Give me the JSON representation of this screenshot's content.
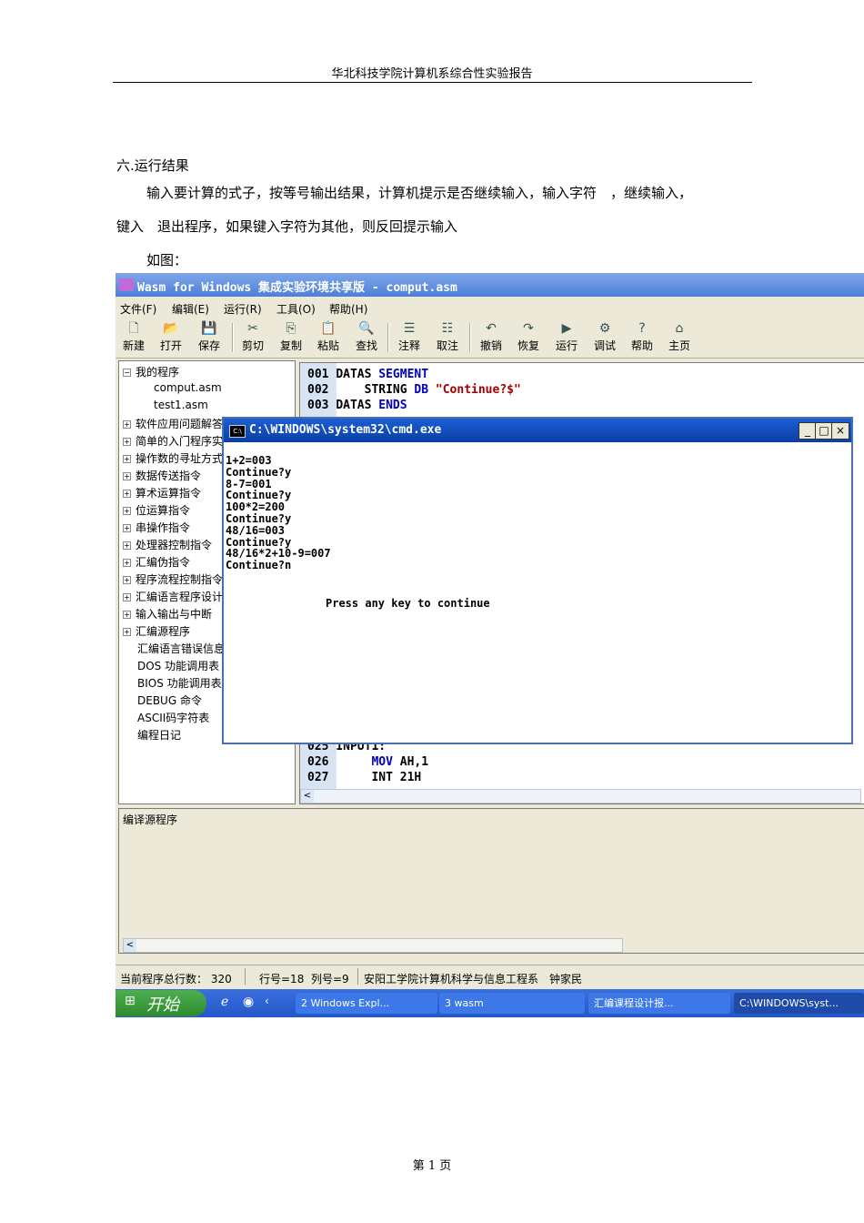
{
  "header": "华北科技学院计算机系综合性实验报告",
  "section_title": "六.运行结果",
  "para1": "输入要计算的式子，按等号输出结果，计算机提示是否继续输入，输入字符　，继续输入，",
  "para2": "键入　退出程序，如果键入字符为其他，则反回提示输入",
  "para3": "如图：",
  "footer": "第 1 页",
  "app": {
    "title": "Wasm for Windows 集成实验环境共享版 - comput.asm",
    "menu": [
      "文件(F)",
      "编辑(E)",
      "运行(R)",
      "工具(O)",
      "帮助(H)"
    ],
    "toolbar": [
      {
        "label": "新建",
        "icon": "new-file-icon",
        "glyph": "🗋"
      },
      {
        "label": "打开",
        "icon": "open-folder-icon",
        "glyph": "📂"
      },
      {
        "label": "保存",
        "icon": "save-icon",
        "glyph": "💾"
      },
      {
        "label": "剪切",
        "icon": "cut-icon",
        "glyph": "✂"
      },
      {
        "label": "复制",
        "icon": "copy-icon",
        "glyph": "⎘"
      },
      {
        "label": "粘贴",
        "icon": "paste-icon",
        "glyph": "📋"
      },
      {
        "label": "查找",
        "icon": "find-icon",
        "glyph": "🔍"
      },
      {
        "label": "注释",
        "icon": "comment-icon",
        "glyph": "☰"
      },
      {
        "label": "取注",
        "icon": "uncomment-icon",
        "glyph": "☷"
      },
      {
        "label": "撤销",
        "icon": "undo-icon",
        "glyph": "↶"
      },
      {
        "label": "恢复",
        "icon": "redo-icon",
        "glyph": "↷"
      },
      {
        "label": "运行",
        "icon": "run-icon",
        "glyph": "▶"
      },
      {
        "label": "调试",
        "icon": "debug-icon",
        "glyph": "⚙"
      },
      {
        "label": "帮助",
        "icon": "help-icon",
        "glyph": "?"
      },
      {
        "label": "主页",
        "icon": "home-icon",
        "glyph": "⌂"
      }
    ],
    "tree": [
      "我的程序",
      "comput.asm",
      "test1.asm",
      "软件应用问题解答",
      "简单的入门程序实例",
      "操作数的寻址方式",
      "数据传送指令",
      "算术运算指令",
      "位运算指令",
      "串操作指令",
      "处理器控制指令",
      "汇编伪指令",
      "程序流程控制指令",
      "汇编语言程序设计",
      "输入输出与中断",
      "汇编源程序",
      "汇编语言错误信息",
      "DOS 功能调用表",
      "BIOS 功能调用表",
      "DEBUG 命令",
      "ASCII码字符表",
      "编程日记"
    ],
    "code_top": [
      {
        "num": "001",
        "a": "DATAS ",
        "kw": "SEGMENT",
        "b": "",
        "s": ""
      },
      {
        "num": "002",
        "a": "    STRING ",
        "kw": "DB",
        "b": " ",
        "s": "\"Continue?$\""
      },
      {
        "num": "003",
        "a": "DATAS ",
        "kw": "ENDS",
        "b": "",
        "s": ""
      }
    ],
    "code_bottom": [
      {
        "num": "025",
        "a": "INPUT1:",
        "kw": "",
        "b": ""
      },
      {
        "num": "026",
        "a": "     ",
        "kw": "MOV",
        "b": " AH,1"
      },
      {
        "num": "027",
        "a": "     ",
        "kw": "",
        "b": "INT 21H"
      }
    ],
    "cmd": {
      "title": "C:\\WINDOWS\\system32\\cmd.exe",
      "icon_text": "C:\\",
      "buttons": [
        "_",
        "□",
        "×"
      ],
      "lines": "1+2=003\nContinue?y\n8-7=001\nContinue?y\n100*2=200\nContinue?y\n48/16=003\nContinue?y\n48/16*2+10-9=007\nContinue?n",
      "press": "Press any key to continue"
    },
    "output_label": "编译源程序",
    "status": {
      "total": "当前程序总行数： 320",
      "pos_row": "行号=18",
      "pos_col": "列号=9",
      "org": "安阳工学院计算机科学与信息工程系　钟家民"
    },
    "taskbar": {
      "start": "开始",
      "items": [
        "2 Windows Expl...",
        "3 wasm",
        "汇编课程设计报...",
        "C:\\WINDOWS\\syst..."
      ]
    }
  }
}
